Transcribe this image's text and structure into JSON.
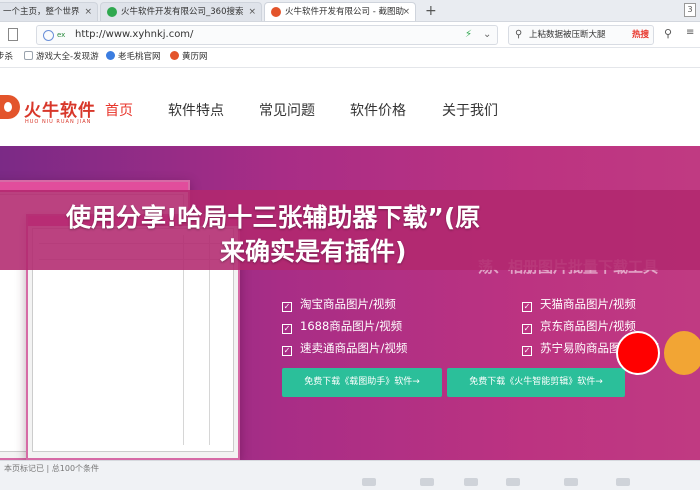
{
  "browser": {
    "tabs": [
      {
        "label": "一个主页，整个世界",
        "icon_color": "#3b7de0",
        "active": false
      },
      {
        "label": "火牛软件开发有限公司_360搜索",
        "icon_color": "#2fa84f",
        "active": false
      },
      {
        "label": "火牛软件开发有限公司 - 截图助",
        "icon_color": "#e3542b",
        "active": true
      }
    ],
    "new_tab": "+",
    "window_count": "3",
    "close_symbol": "×",
    "address": {
      "badge": "ex",
      "url": "http://www.xyhnkj.com/",
      "bolt": "⚡",
      "chevron": "⌄"
    },
    "search": {
      "text": "上粘数据被压断大腿",
      "hot_label": "热搜",
      "button_icon": "⚲",
      "more_icon": "≡"
    },
    "favorites": [
      {
        "label": "步杀",
        "icon_color": "#ffffff"
      },
      {
        "label": "游戏大全-发现游",
        "icon_color": "#9aa3ad"
      },
      {
        "label": "老毛桃官网",
        "icon_color": "#3b7de0"
      },
      {
        "label": "黄历网",
        "icon_color": "#e3542b"
      }
    ]
  },
  "site": {
    "logo_name": "火牛软件",
    "logo_sub": "HUO NIU RUAN JIAN",
    "nav": [
      "首页",
      "软件特点",
      "常见问题",
      "软件价格",
      "关于我们"
    ],
    "headline_line1": "使用分享!哈局十三张辅助器下载”(原",
    "headline_line2": "来确实是有插件)",
    "tagline": "下载工具",
    "tagline_prefix": "荡、相册图片批量",
    "features": [
      "淘宝商品图片/视频",
      "1688商品图片/视频",
      "速卖通商品图片/视频",
      "天猫商品图片/视频",
      "京东商品图片/视频",
      "苏宁易购商品图片/视频"
    ],
    "check_symbol": "✓",
    "buttons": [
      "免费下载《载图助手》软件→",
      "免费下载《火牛智能剪辑》软件→"
    ],
    "accent": "#e8352b",
    "hero_color": "#a82d86",
    "button_color": "#2bbf9a"
  },
  "statusbar": {
    "text": "本页标记已 | 总100个条件"
  }
}
